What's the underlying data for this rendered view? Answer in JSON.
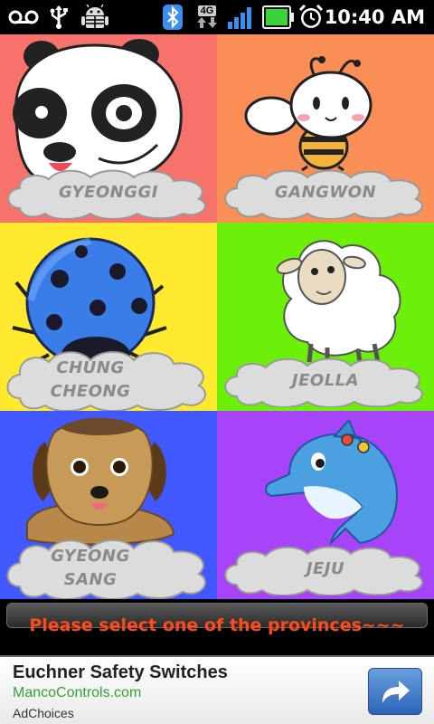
{
  "status_bar": {
    "network_type": "4G",
    "time": "10:40 AM"
  },
  "provinces": [
    {
      "label": "GYEONGGI",
      "label_lines": [
        "GYEONGGI"
      ],
      "background": "#f7726a",
      "animal": "panda"
    },
    {
      "label": "GANGWON",
      "label_lines": [
        "GANGWON"
      ],
      "background": "#f98e56",
      "animal": "bee"
    },
    {
      "label": "CHUNG CHEONG",
      "label_lines": [
        "CHUNG",
        "CHEONG"
      ],
      "background": "#ffea2f",
      "animal": "ladybug"
    },
    {
      "label": "JEOLLA",
      "label_lines": [
        "JEOLLA"
      ],
      "background": "#6cf00a",
      "animal": "sheep"
    },
    {
      "label": "GYEONG SANG",
      "label_lines": [
        "GYEONG",
        "SANG"
      ],
      "background": "#4157ff",
      "animal": "puppy"
    },
    {
      "label": "JEJU",
      "label_lines": [
        "JEJU"
      ],
      "background": "#a743f9",
      "animal": "dolphin"
    }
  ],
  "instruction": "Please select one of the provinces~~~",
  "ad": {
    "title": "Euchner Safety Switches",
    "url": "MancoControls.com",
    "choices": "AdChoices"
  },
  "colors": {
    "instruction_text": "#ff4a1a",
    "ad_url": "#38a038"
  }
}
